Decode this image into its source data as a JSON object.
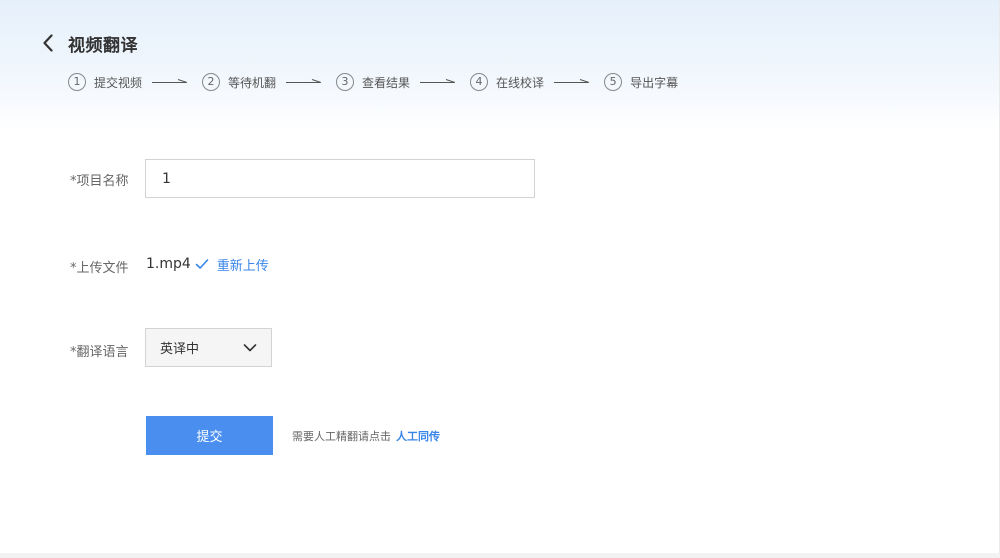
{
  "header": {
    "back_icon": "chevron-left-icon",
    "title": "视频翻译"
  },
  "steps": [
    {
      "num": "1",
      "label": "提交视频"
    },
    {
      "num": "2",
      "label": "等待机翻"
    },
    {
      "num": "3",
      "label": "查看结果"
    },
    {
      "num": "4",
      "label": "在线校译"
    },
    {
      "num": "5",
      "label": "导出字幕"
    }
  ],
  "form": {
    "project_name": {
      "label": "*项目名称",
      "value": "1"
    },
    "upload": {
      "label": "*上传文件",
      "file_name": "1.mp4",
      "status_icon": "check-icon",
      "reupload_label": "重新上传"
    },
    "language": {
      "label": "*翻译语言",
      "selected": "英译中",
      "icon": "chevron-down-icon"
    }
  },
  "actions": {
    "submit_label": "提交",
    "hint_text": "需要人工精翻请点击",
    "hint_link": "人工同传"
  },
  "colors": {
    "accent": "#4a8ff0",
    "link": "#3a86e8",
    "header_bg": "#e6f0fb"
  }
}
